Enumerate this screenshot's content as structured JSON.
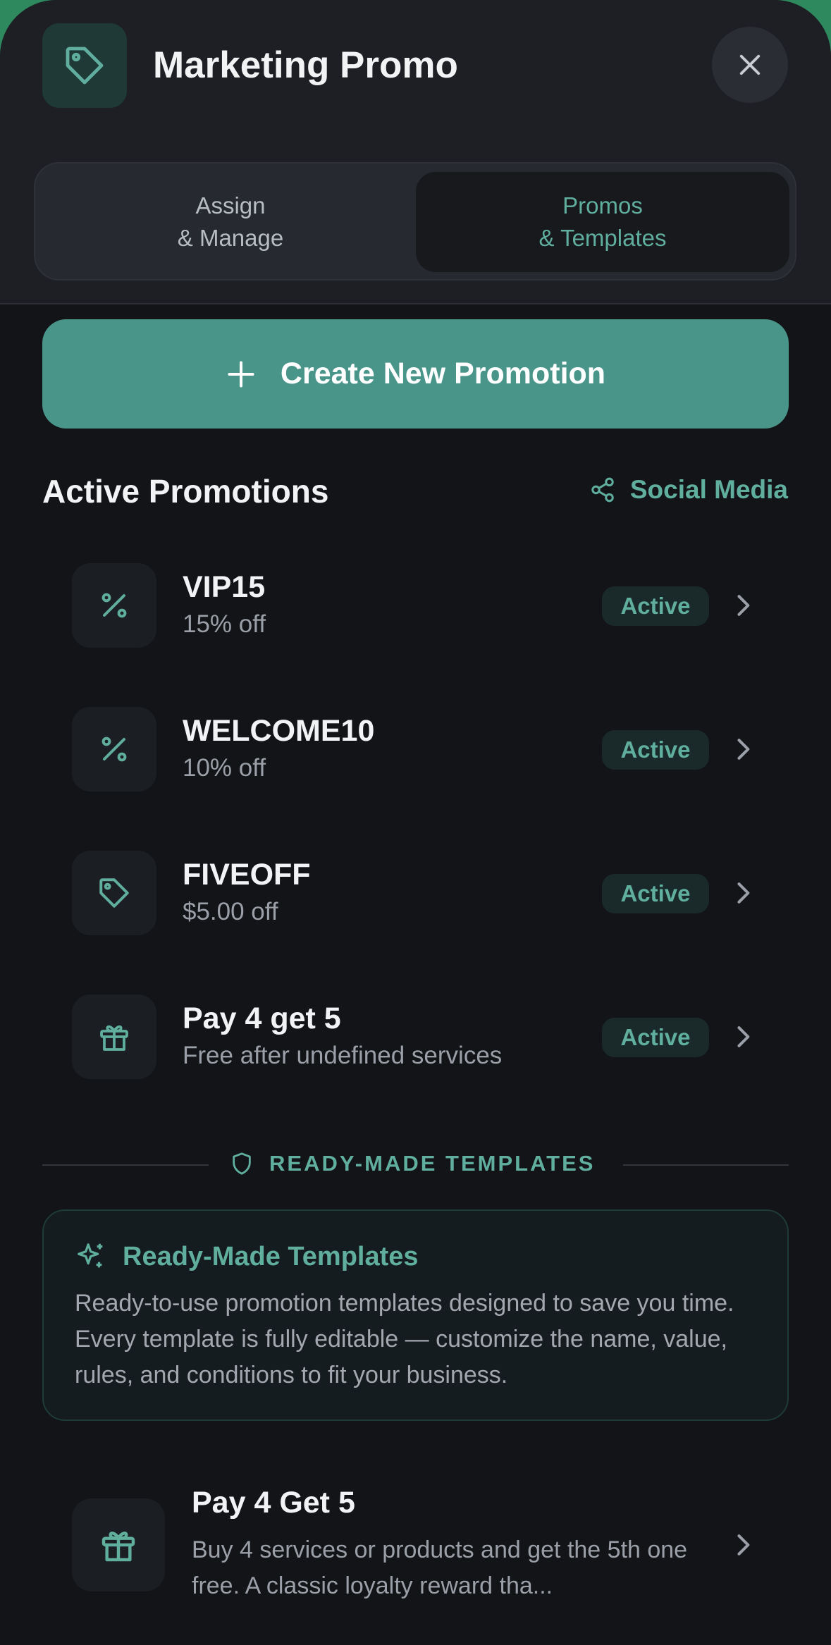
{
  "header": {
    "title": "Marketing Promo",
    "icon": "tag-icon",
    "close_icon": "close-icon"
  },
  "tabs": [
    {
      "line1": "Assign",
      "line2": "& Manage",
      "selected": false
    },
    {
      "line1": "Promos",
      "line2": "& Templates",
      "selected": true
    }
  ],
  "create_button": {
    "label": "Create New Promotion",
    "icon": "plus-icon"
  },
  "active_section": {
    "title": "Active Promotions",
    "social_label": "Social Media",
    "social_icon": "share-icon"
  },
  "promotions": [
    {
      "name": "VIP15",
      "detail": "15% off",
      "status": "Active",
      "icon": "percent-icon"
    },
    {
      "name": "WELCOME10",
      "detail": "10% off",
      "status": "Active",
      "icon": "percent-icon"
    },
    {
      "name": "FIVEOFF",
      "detail": "$5.00 off",
      "status": "Active",
      "icon": "tag-icon"
    },
    {
      "name": "Pay 4 get 5",
      "detail": "Free after undefined services",
      "status": "Active",
      "icon": "gift-icon"
    }
  ],
  "templates_divider": {
    "label": "READY-MADE TEMPLATES",
    "icon": "shield-icon"
  },
  "info_card": {
    "title": "Ready-Made Templates",
    "icon": "sparkles-icon",
    "body": "Ready-to-use promotion templates designed to save you time. Every template is fully editable — customize the name, value, rules, and conditions to fit your business."
  },
  "templates": [
    {
      "name": "Pay 4 Get 5",
      "description": "Buy 4 services or products and get the 5th one free. A classic loyalty reward tha...",
      "icon": "gift-icon"
    }
  ],
  "colors": {
    "accent": "#5fae9e",
    "button": "#4a958a",
    "background": "#131418",
    "header": "#1d1f24"
  }
}
